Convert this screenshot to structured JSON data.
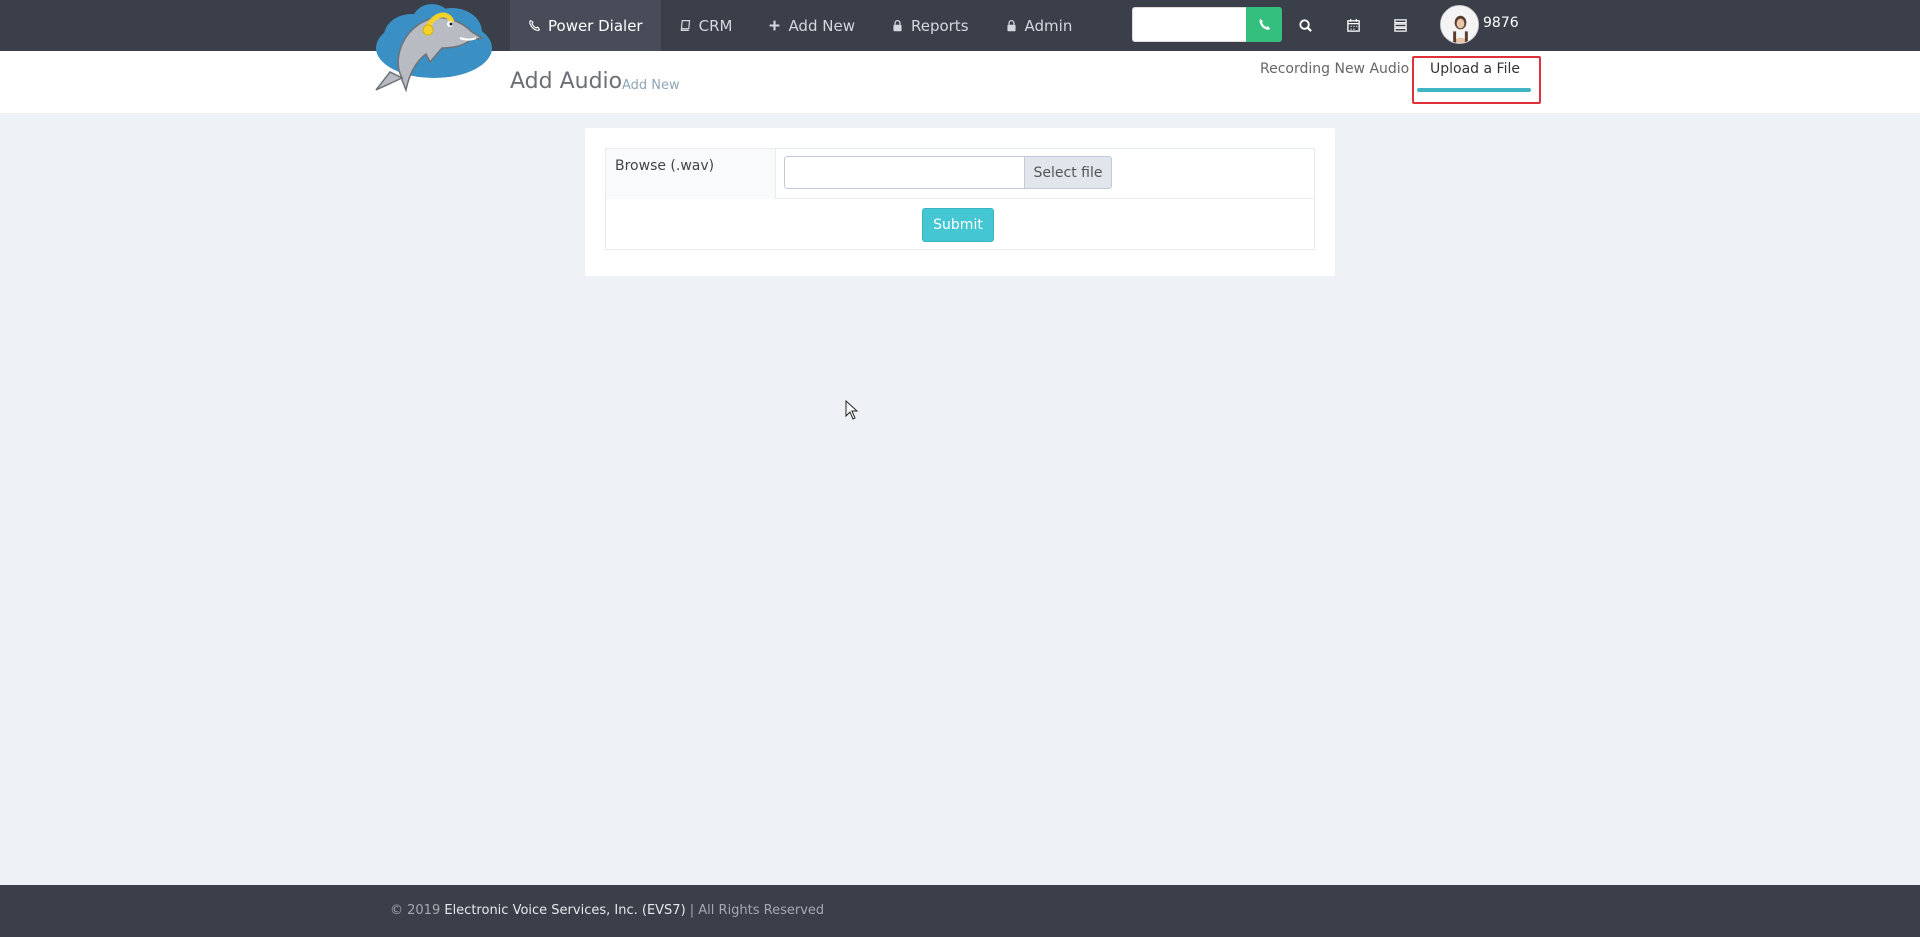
{
  "navbar": {
    "items": [
      {
        "label": "Power Dialer",
        "icon": "phone-handset-icon",
        "active": true
      },
      {
        "label": "CRM",
        "icon": "book-icon"
      },
      {
        "label": "Add New",
        "icon": "plus-icon"
      },
      {
        "label": "Reports",
        "icon": "lock-icon"
      },
      {
        "label": "Admin",
        "icon": "lock-icon"
      }
    ],
    "dial_input_placeholder": "",
    "user_extension": "9876"
  },
  "header": {
    "title": "Add Audio",
    "subtitle": "Add New",
    "tabs": {
      "recording": "Recording New Audio",
      "upload": "Upload a File"
    }
  },
  "form": {
    "browse_label": "Browse (.wav)",
    "select_file_label": "Select file",
    "submit_label": "Submit"
  },
  "footer": {
    "copyright": "© 2019 ",
    "company": "Electronic Voice Services, Inc. (EVS7)",
    "rights": " | All Rights Reserved"
  },
  "colors": {
    "navbar": "#3b3f4a",
    "accent": "#45c6d3",
    "dial_green": "#35bf7f",
    "highlight_red": "#e0303a"
  }
}
